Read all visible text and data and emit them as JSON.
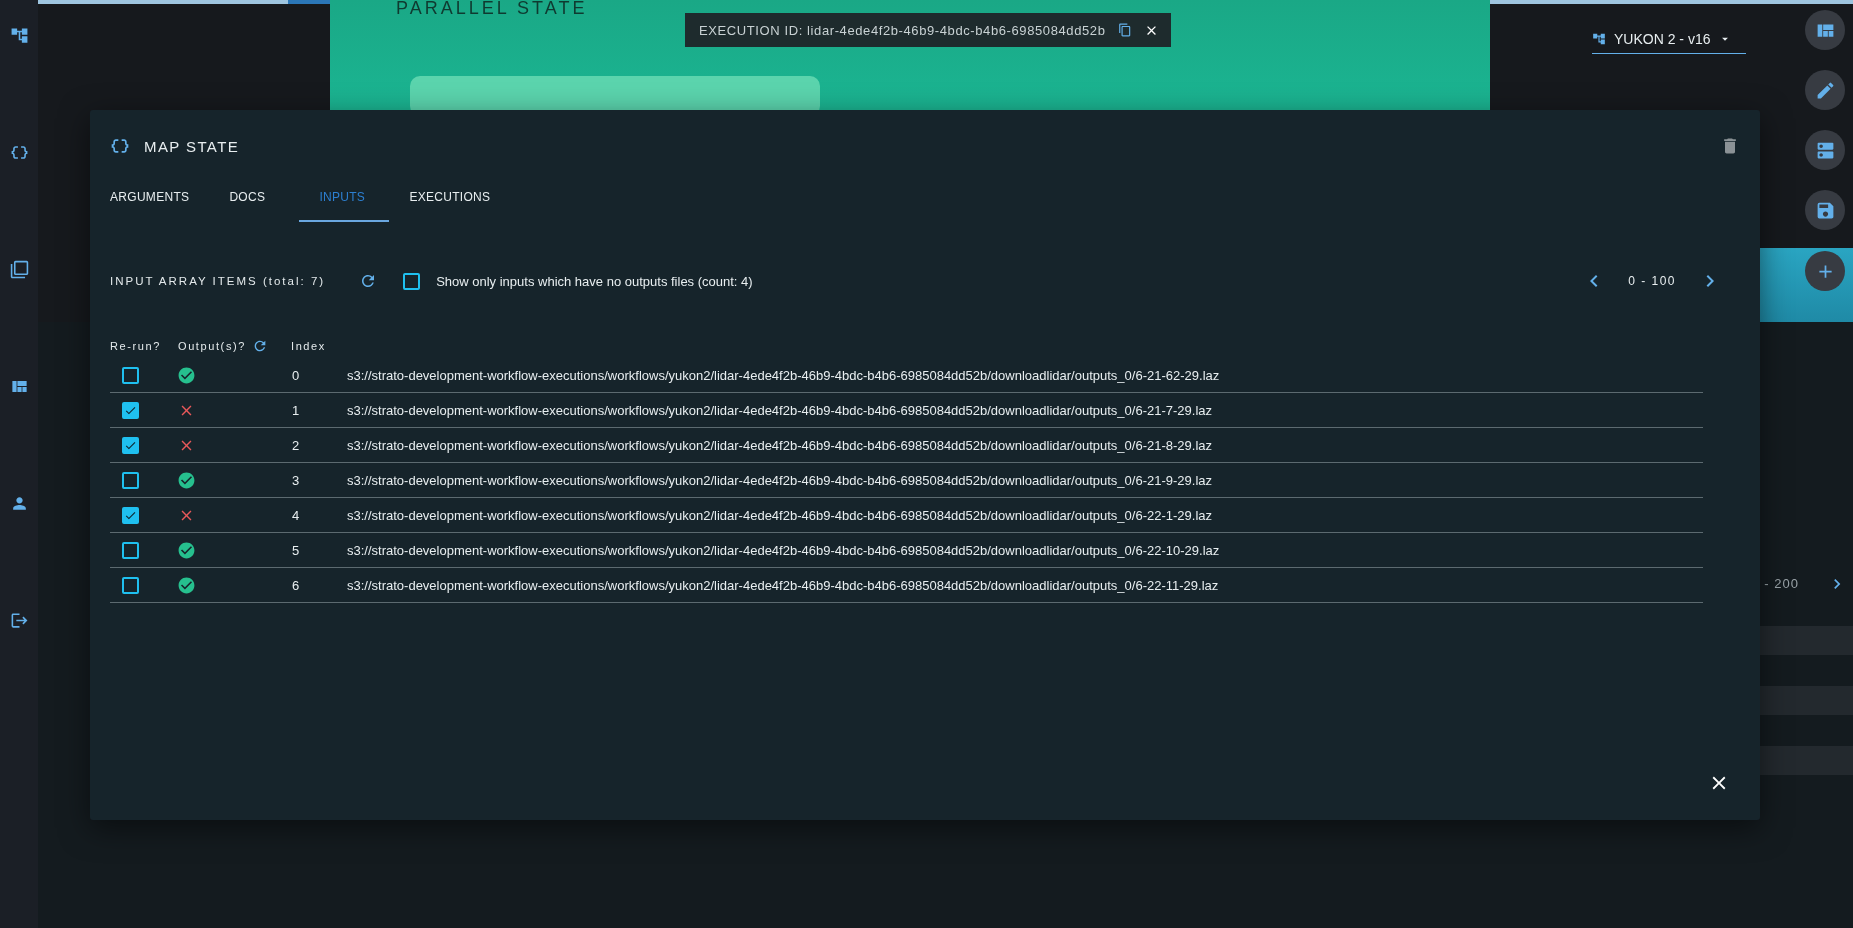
{
  "canvas": {
    "parallel_state": {
      "title": "PARALLEL STATE"
    },
    "execution": {
      "label": "EXECUTION ID: lidar-4ede4f2b-46b9-4bdc-b4b6-6985084dd52b"
    },
    "version_selector": {
      "value": "YUKON 2 - v16"
    },
    "side_range": "- 200"
  },
  "dialog": {
    "title": "MAP STATE",
    "tabs": [
      {
        "label": "ARGUMENTS",
        "selected": false
      },
      {
        "label": "DOCS",
        "selected": false
      },
      {
        "label": "INPUTS",
        "selected": true
      },
      {
        "label": "EXECUTIONS",
        "selected": false
      }
    ],
    "toolbar": {
      "title": "INPUT ARRAY ITEMS (total: 7)",
      "filter": {
        "label": "Show only inputs which have no outputs files (count: 4)",
        "checked": false
      },
      "range": "0 - 100"
    },
    "columns": [
      "Re-run?",
      "Output(s)?",
      "Index"
    ],
    "rows": [
      {
        "rerun": false,
        "has_output": true,
        "index": "0",
        "path": "s3://strato-development-workflow-executions/workflows/yukon2/lidar-4ede4f2b-46b9-4bdc-b4b6-6985084dd52b/downloadlidar/outputs_0/6-21-62-29.laz"
      },
      {
        "rerun": true,
        "has_output": false,
        "index": "1",
        "path": "s3://strato-development-workflow-executions/workflows/yukon2/lidar-4ede4f2b-46b9-4bdc-b4b6-6985084dd52b/downloadlidar/outputs_0/6-21-7-29.laz"
      },
      {
        "rerun": true,
        "has_output": false,
        "index": "2",
        "path": "s3://strato-development-workflow-executions/workflows/yukon2/lidar-4ede4f2b-46b9-4bdc-b4b6-6985084dd52b/downloadlidar/outputs_0/6-21-8-29.laz"
      },
      {
        "rerun": false,
        "has_output": true,
        "index": "3",
        "path": "s3://strato-development-workflow-executions/workflows/yukon2/lidar-4ede4f2b-46b9-4bdc-b4b6-6985084dd52b/downloadlidar/outputs_0/6-21-9-29.laz"
      },
      {
        "rerun": true,
        "has_output": false,
        "index": "4",
        "path": "s3://strato-development-workflow-executions/workflows/yukon2/lidar-4ede4f2b-46b9-4bdc-b4b6-6985084dd52b/downloadlidar/outputs_0/6-22-1-29.laz"
      },
      {
        "rerun": false,
        "has_output": true,
        "index": "5",
        "path": "s3://strato-development-workflow-executions/workflows/yukon2/lidar-4ede4f2b-46b9-4bdc-b4b6-6985084dd52b/downloadlidar/outputs_0/6-22-10-29.laz"
      },
      {
        "rerun": false,
        "has_output": true,
        "index": "6",
        "path": "s3://strato-development-workflow-executions/workflows/yukon2/lidar-4ede4f2b-46b9-4bdc-b4b6-6985084dd52b/downloadlidar/outputs_0/6-22-11-29.laz"
      }
    ]
  }
}
